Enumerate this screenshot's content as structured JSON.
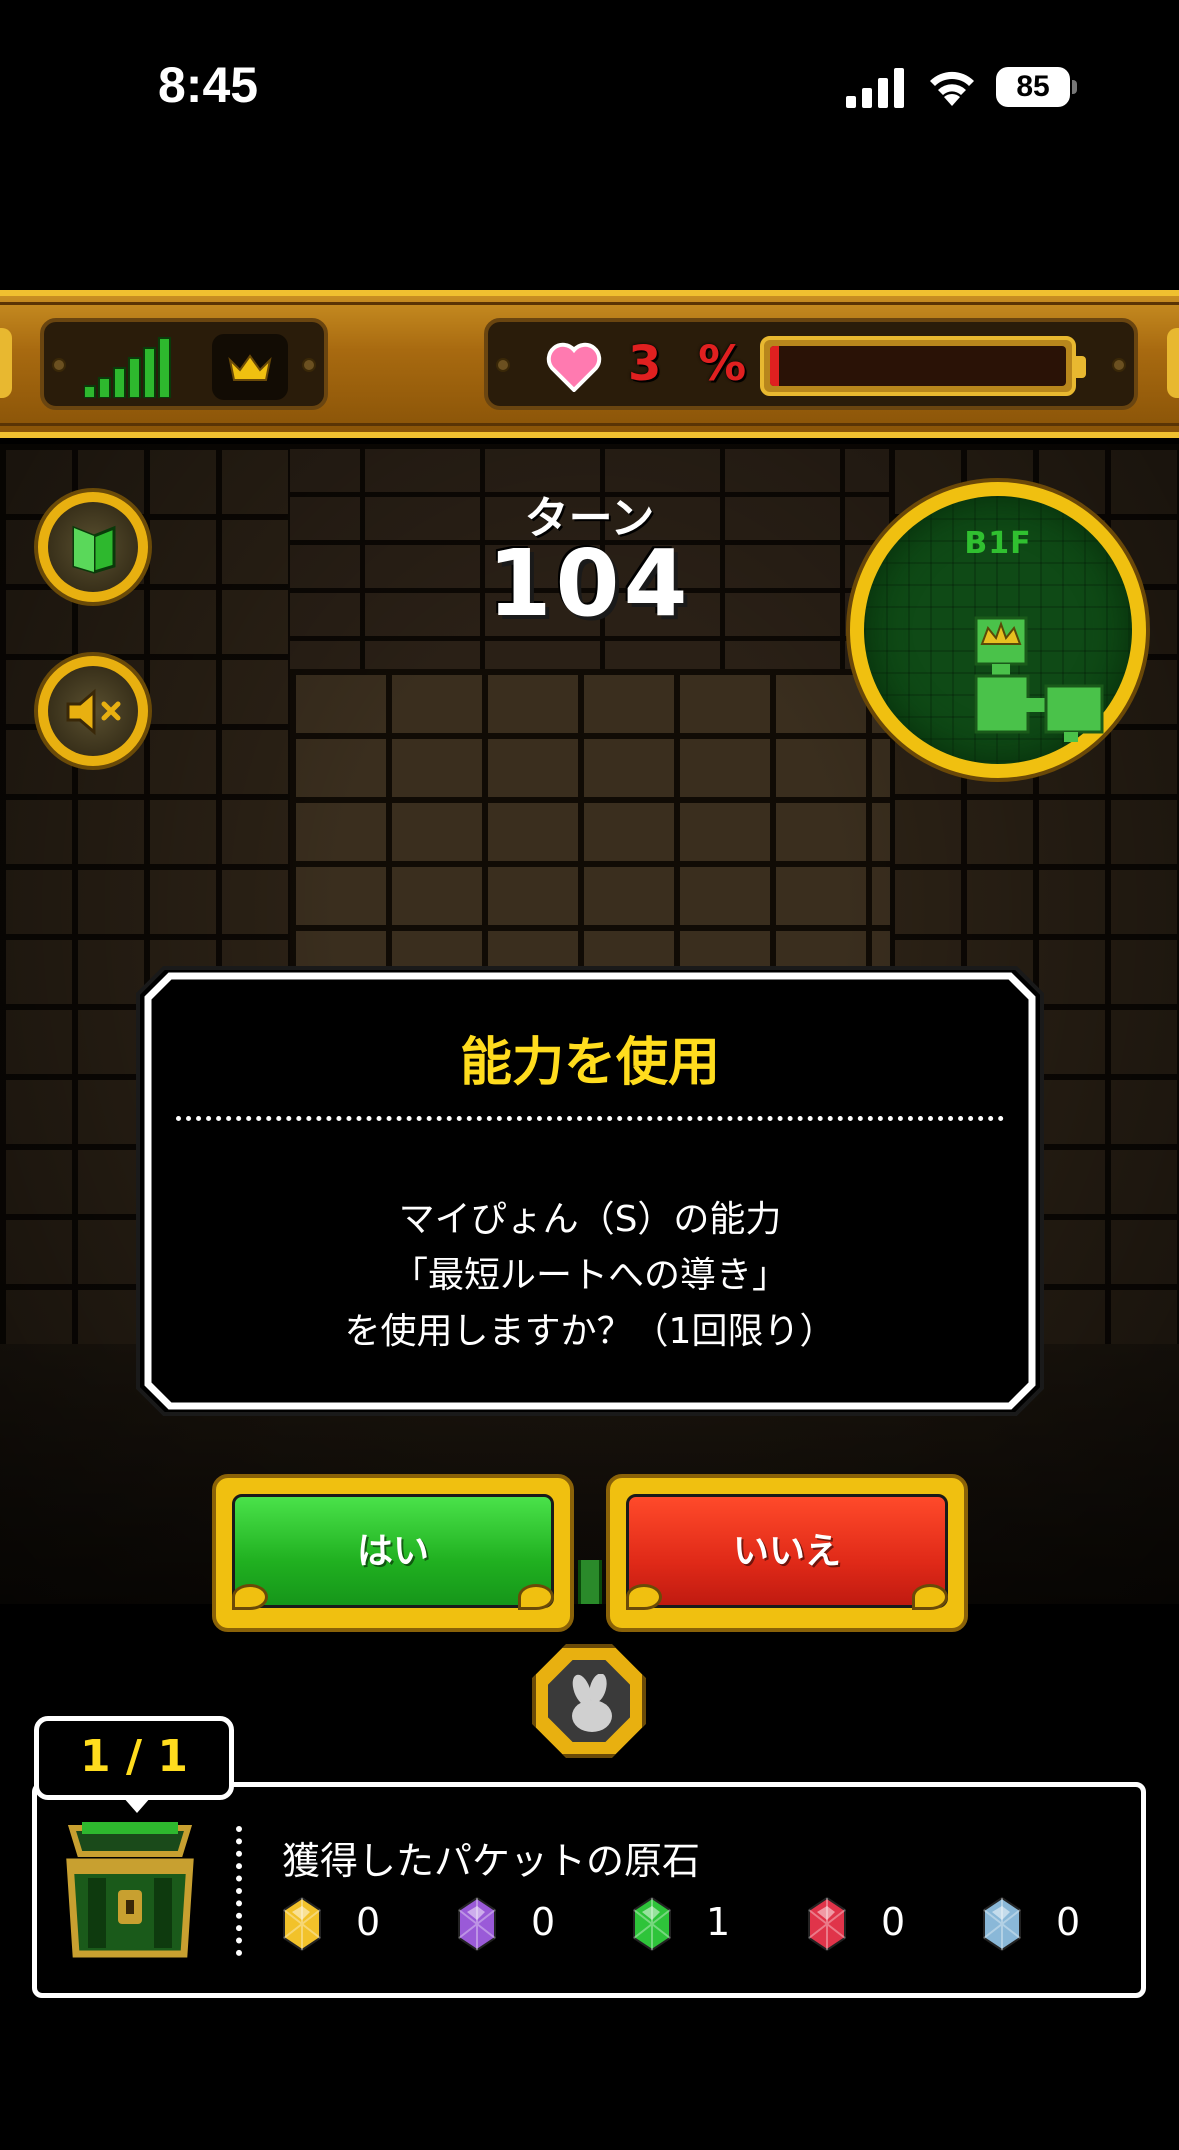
{
  "status_bar": {
    "time": "8:45",
    "battery": "85"
  },
  "hud": {
    "hp_percent_label": "3 %",
    "hp_fraction": 0.03
  },
  "turn": {
    "label": "ターン",
    "value": "104"
  },
  "minimap": {
    "floor": "B1F"
  },
  "dialog": {
    "title": "能力を使用",
    "lines": [
      "マイぴょん（S）の能力",
      "「最短ルートへの導き」",
      "を使用しますか？（1回限り）"
    ]
  },
  "buttons": {
    "yes": "はい",
    "no": "いいえ"
  },
  "loot": {
    "page_counter": "1 / 1",
    "title": "獲得したパケットの原石",
    "gems": [
      {
        "name": "yellow-gem",
        "color": "#f2c22a",
        "count": "0"
      },
      {
        "name": "rainbow-gem",
        "color": "#9a5ad8",
        "count": "0"
      },
      {
        "name": "green-gem",
        "color": "#2ec43a",
        "count": "1"
      },
      {
        "name": "red-gem",
        "color": "#e0344a",
        "count": "0"
      },
      {
        "name": "blue-gem",
        "color": "#8ab8d8",
        "count": "0"
      }
    ]
  },
  "colors": {
    "gold": "#f0c010",
    "accent_yellow": "#ffdc1e",
    "yes_green": "#20b020",
    "no_red": "#e02a18",
    "hp_red": "#e02020"
  }
}
